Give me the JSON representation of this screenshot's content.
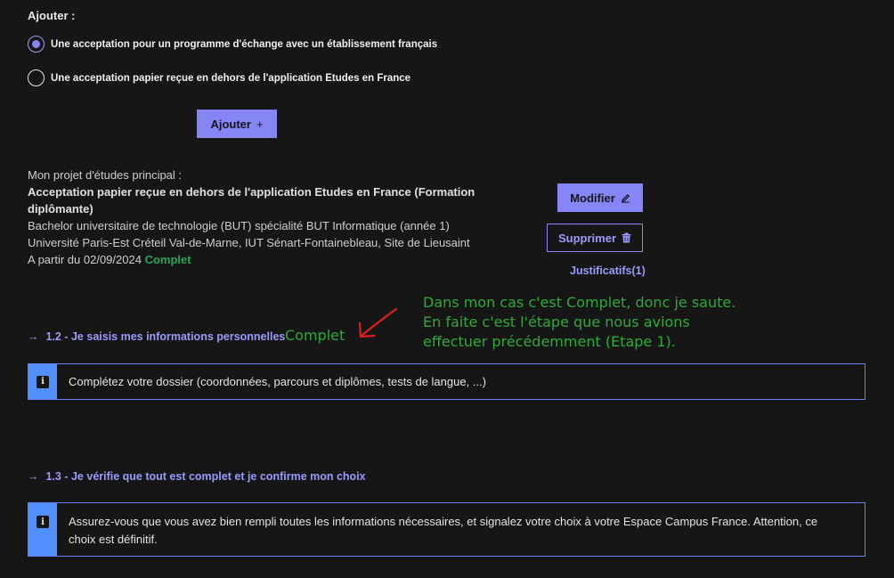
{
  "add_section": {
    "label": "Ajouter :",
    "options": [
      {
        "label": "Une acceptation pour un programme d'échange avec un établissement français",
        "selected": true
      },
      {
        "label": "Une acceptation papier reçue en dehors de l'application Etudes en France",
        "selected": false
      }
    ],
    "add_button": {
      "label": "Ajouter",
      "icon": "+"
    }
  },
  "project": {
    "heading": "Mon projet d'études principal :",
    "title": "Acceptation papier reçue en dehors de l'application Etudes en France (Formation diplômante)",
    "program": "Bachelor universitaire de technologie (BUT) spécialité BUT Informatique (année 1)",
    "institution": "Université Paris-Est Créteil Val-de-Marne, IUT Sénart-Fontainebleau, Site de Lieusaint",
    "start": "A partir du 02/09/2024",
    "status": "Complet",
    "modify_button": "Modifier",
    "delete_button": "Supprimer",
    "justificatifs": "Justificatifs(1)"
  },
  "steps": [
    {
      "arrow": "→",
      "title": "1.2 - Je saisis mes informations personnelles",
      "notice_icon": "i",
      "notice": "Complétez votre dossier (coordonnées, parcours et diplômes, tests de langue, ...)"
    },
    {
      "arrow": "→",
      "title": "1.3 - Je vérifie que tout est complet et je confirme mon choix",
      "notice_icon": "i",
      "notice": "Assurez-vous que vous avez bien rempli toutes les informations nécessaires, et signalez votre choix à votre Espace Campus France. Attention, ce choix est définitif."
    }
  ],
  "annotation": {
    "complete_label": "Complet",
    "lines": [
      "Dans mon cas c'est Complet, donc je saute.",
      "En faite c'est l'étape que nous  avions",
      "effectuer précédemment (Etape 1)."
    ],
    "color": "#2eaa3a",
    "arrow_color": "#e0201c"
  },
  "colors": {
    "background": "#161616",
    "accent": "#8585f6",
    "link": "#9a9aff",
    "success": "#27a658",
    "info_bar": "#518fff"
  }
}
